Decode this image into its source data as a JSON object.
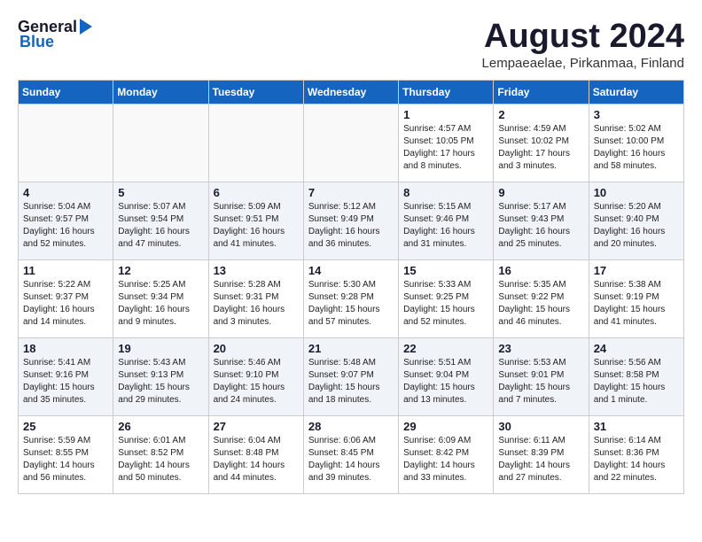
{
  "header": {
    "logo_general": "General",
    "logo_blue": "Blue",
    "month_title": "August 2024",
    "location": "Lempaeaelae, Pirkanmaa, Finland"
  },
  "weekdays": [
    "Sunday",
    "Monday",
    "Tuesday",
    "Wednesday",
    "Thursday",
    "Friday",
    "Saturday"
  ],
  "weeks": [
    [
      {
        "day": "",
        "text": ""
      },
      {
        "day": "",
        "text": ""
      },
      {
        "day": "",
        "text": ""
      },
      {
        "day": "",
        "text": ""
      },
      {
        "day": "1",
        "text": "Sunrise: 4:57 AM\nSunset: 10:05 PM\nDaylight: 17 hours\nand 8 minutes."
      },
      {
        "day": "2",
        "text": "Sunrise: 4:59 AM\nSunset: 10:02 PM\nDaylight: 17 hours\nand 3 minutes."
      },
      {
        "day": "3",
        "text": "Sunrise: 5:02 AM\nSunset: 10:00 PM\nDaylight: 16 hours\nand 58 minutes."
      }
    ],
    [
      {
        "day": "4",
        "text": "Sunrise: 5:04 AM\nSunset: 9:57 PM\nDaylight: 16 hours\nand 52 minutes."
      },
      {
        "day": "5",
        "text": "Sunrise: 5:07 AM\nSunset: 9:54 PM\nDaylight: 16 hours\nand 47 minutes."
      },
      {
        "day": "6",
        "text": "Sunrise: 5:09 AM\nSunset: 9:51 PM\nDaylight: 16 hours\nand 41 minutes."
      },
      {
        "day": "7",
        "text": "Sunrise: 5:12 AM\nSunset: 9:49 PM\nDaylight: 16 hours\nand 36 minutes."
      },
      {
        "day": "8",
        "text": "Sunrise: 5:15 AM\nSunset: 9:46 PM\nDaylight: 16 hours\nand 31 minutes."
      },
      {
        "day": "9",
        "text": "Sunrise: 5:17 AM\nSunset: 9:43 PM\nDaylight: 16 hours\nand 25 minutes."
      },
      {
        "day": "10",
        "text": "Sunrise: 5:20 AM\nSunset: 9:40 PM\nDaylight: 16 hours\nand 20 minutes."
      }
    ],
    [
      {
        "day": "11",
        "text": "Sunrise: 5:22 AM\nSunset: 9:37 PM\nDaylight: 16 hours\nand 14 minutes."
      },
      {
        "day": "12",
        "text": "Sunrise: 5:25 AM\nSunset: 9:34 PM\nDaylight: 16 hours\nand 9 minutes."
      },
      {
        "day": "13",
        "text": "Sunrise: 5:28 AM\nSunset: 9:31 PM\nDaylight: 16 hours\nand 3 minutes."
      },
      {
        "day": "14",
        "text": "Sunrise: 5:30 AM\nSunset: 9:28 PM\nDaylight: 15 hours\nand 57 minutes."
      },
      {
        "day": "15",
        "text": "Sunrise: 5:33 AM\nSunset: 9:25 PM\nDaylight: 15 hours\nand 52 minutes."
      },
      {
        "day": "16",
        "text": "Sunrise: 5:35 AM\nSunset: 9:22 PM\nDaylight: 15 hours\nand 46 minutes."
      },
      {
        "day": "17",
        "text": "Sunrise: 5:38 AM\nSunset: 9:19 PM\nDaylight: 15 hours\nand 41 minutes."
      }
    ],
    [
      {
        "day": "18",
        "text": "Sunrise: 5:41 AM\nSunset: 9:16 PM\nDaylight: 15 hours\nand 35 minutes."
      },
      {
        "day": "19",
        "text": "Sunrise: 5:43 AM\nSunset: 9:13 PM\nDaylight: 15 hours\nand 29 minutes."
      },
      {
        "day": "20",
        "text": "Sunrise: 5:46 AM\nSunset: 9:10 PM\nDaylight: 15 hours\nand 24 minutes."
      },
      {
        "day": "21",
        "text": "Sunrise: 5:48 AM\nSunset: 9:07 PM\nDaylight: 15 hours\nand 18 minutes."
      },
      {
        "day": "22",
        "text": "Sunrise: 5:51 AM\nSunset: 9:04 PM\nDaylight: 15 hours\nand 13 minutes."
      },
      {
        "day": "23",
        "text": "Sunrise: 5:53 AM\nSunset: 9:01 PM\nDaylight: 15 hours\nand 7 minutes."
      },
      {
        "day": "24",
        "text": "Sunrise: 5:56 AM\nSunset: 8:58 PM\nDaylight: 15 hours\nand 1 minute."
      }
    ],
    [
      {
        "day": "25",
        "text": "Sunrise: 5:59 AM\nSunset: 8:55 PM\nDaylight: 14 hours\nand 56 minutes."
      },
      {
        "day": "26",
        "text": "Sunrise: 6:01 AM\nSunset: 8:52 PM\nDaylight: 14 hours\nand 50 minutes."
      },
      {
        "day": "27",
        "text": "Sunrise: 6:04 AM\nSunset: 8:48 PM\nDaylight: 14 hours\nand 44 minutes."
      },
      {
        "day": "28",
        "text": "Sunrise: 6:06 AM\nSunset: 8:45 PM\nDaylight: 14 hours\nand 39 minutes."
      },
      {
        "day": "29",
        "text": "Sunrise: 6:09 AM\nSunset: 8:42 PM\nDaylight: 14 hours\nand 33 minutes."
      },
      {
        "day": "30",
        "text": "Sunrise: 6:11 AM\nSunset: 8:39 PM\nDaylight: 14 hours\nand 27 minutes."
      },
      {
        "day": "31",
        "text": "Sunrise: 6:14 AM\nSunset: 8:36 PM\nDaylight: 14 hours\nand 22 minutes."
      }
    ]
  ]
}
